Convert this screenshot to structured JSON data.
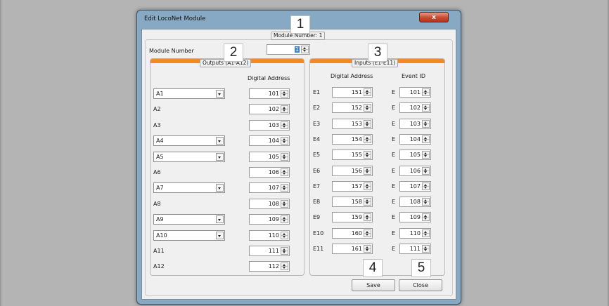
{
  "window": {
    "title": "Edit LocoNet Module",
    "close_glyph": "x"
  },
  "module": {
    "legend": "Module Number: 1",
    "label": "Module Number",
    "value": "1"
  },
  "outputs": {
    "legend": "Outputs (A1-A12)",
    "column_header": "Digital Address",
    "rows": [
      {
        "name": "A1",
        "address": "101",
        "has_combo": true
      },
      {
        "name": "A2",
        "address": "102",
        "has_combo": false
      },
      {
        "name": "A3",
        "address": "103",
        "has_combo": false
      },
      {
        "name": "A4",
        "address": "104",
        "has_combo": true
      },
      {
        "name": "A5",
        "address": "105",
        "has_combo": true
      },
      {
        "name": "A6",
        "address": "106",
        "has_combo": false
      },
      {
        "name": "A7",
        "address": "107",
        "has_combo": true
      },
      {
        "name": "A8",
        "address": "108",
        "has_combo": false
      },
      {
        "name": "A9",
        "address": "109",
        "has_combo": true
      },
      {
        "name": "A10",
        "address": "110",
        "has_combo": true
      },
      {
        "name": "A11",
        "address": "111",
        "has_combo": false
      },
      {
        "name": "A12",
        "address": "112",
        "has_combo": false
      }
    ]
  },
  "inputs": {
    "legend": "Inputs (E1-E11)",
    "column_header_address": "Digital Address",
    "column_header_event": "Event ID",
    "event_prefix": "E",
    "rows": [
      {
        "name": "E1",
        "address": "151",
        "event": "101"
      },
      {
        "name": "E2",
        "address": "152",
        "event": "102"
      },
      {
        "name": "E3",
        "address": "153",
        "event": "103"
      },
      {
        "name": "E4",
        "address": "154",
        "event": "104"
      },
      {
        "name": "E5",
        "address": "155",
        "event": "105"
      },
      {
        "name": "E6",
        "address": "156",
        "event": "106"
      },
      {
        "name": "E7",
        "address": "157",
        "event": "107"
      },
      {
        "name": "E8",
        "address": "158",
        "event": "108"
      },
      {
        "name": "E9",
        "address": "159",
        "event": "109"
      },
      {
        "name": "E10",
        "address": "160",
        "event": "110"
      },
      {
        "name": "E11",
        "address": "161",
        "event": "111"
      }
    ]
  },
  "buttons": {
    "save": "Save",
    "close": "Close"
  },
  "callouts": [
    "1",
    "2",
    "3",
    "4",
    "5"
  ],
  "colors": {
    "accent_orange": "#f08a25",
    "title_bar": "#87a9c3",
    "close_red": "#c94a32"
  }
}
